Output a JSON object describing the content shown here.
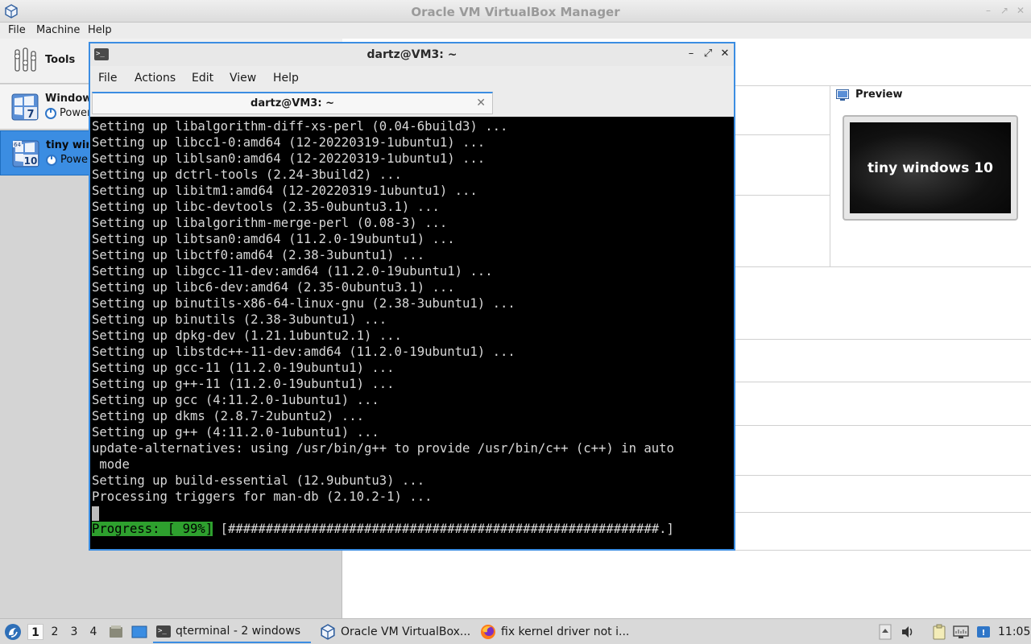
{
  "vbox": {
    "title": "Oracle VM VirtualBox Manager",
    "menu": {
      "file": "File",
      "machine": "Machine",
      "help": "Help"
    },
    "sidebar": {
      "tools_label": "Tools",
      "vms": [
        {
          "name": "Window",
          "state": "Power",
          "badge": "7"
        },
        {
          "name": "tiny win",
          "state": "Power",
          "badge": "10",
          "arch": "64"
        }
      ]
    },
    "preview": {
      "title": "Preview",
      "screen_text": "tiny windows 10"
    }
  },
  "terminal": {
    "title": "dartz@VM3: ~",
    "menu": [
      "File",
      "Actions",
      "Edit",
      "View",
      "Help"
    ],
    "tab_label": "dartz@VM3: ~",
    "lines": [
      "Setting up libalgorithm-diff-xs-perl (0.04-6build3) ...",
      "Setting up libcc1-0:amd64 (12-20220319-1ubuntu1) ...",
      "Setting up liblsan0:amd64 (12-20220319-1ubuntu1) ...",
      "Setting up dctrl-tools (2.24-3build2) ...",
      "Setting up libitm1:amd64 (12-20220319-1ubuntu1) ...",
      "Setting up libc-devtools (2.35-0ubuntu3.1) ...",
      "Setting up libalgorithm-merge-perl (0.08-3) ...",
      "Setting up libtsan0:amd64 (11.2.0-19ubuntu1) ...",
      "Setting up libctf0:amd64 (2.38-3ubuntu1) ...",
      "Setting up libgcc-11-dev:amd64 (11.2.0-19ubuntu1) ...",
      "Setting up libc6-dev:amd64 (2.35-0ubuntu3.1) ...",
      "Setting up binutils-x86-64-linux-gnu (2.38-3ubuntu1) ...",
      "Setting up binutils (2.38-3ubuntu1) ...",
      "Setting up dpkg-dev (1.21.1ubuntu2.1) ...",
      "Setting up libstdc++-11-dev:amd64 (11.2.0-19ubuntu1) ...",
      "Setting up gcc-11 (11.2.0-19ubuntu1) ...",
      "Setting up g++-11 (11.2.0-19ubuntu1) ...",
      "Setting up gcc (4:11.2.0-1ubuntu1) ...",
      "Setting up dkms (2.8.7-2ubuntu2) ...",
      "Setting up g++ (4:11.2.0-1ubuntu1) ...",
      "update-alternatives: using /usr/bin/g++ to provide /usr/bin/c++ (c++) in auto",
      " mode",
      "Setting up build-essential (12.9ubuntu3) ...",
      "Processing triggers for man-db (2.10.2-1) ..."
    ],
    "progress_label": "Progress: [ 99%]",
    "progress_bar": " [#########################################################.]",
    "progress_percent": 99
  },
  "taskbar": {
    "desktops": [
      "1",
      "2",
      "3",
      "4"
    ],
    "tasks": [
      {
        "label": "qterminal - 2 windows"
      },
      {
        "label": "Oracle VM VirtualBox..."
      },
      {
        "label": "fix kernel driver not i..."
      }
    ],
    "clock": "11:05"
  },
  "colors": {
    "accent": "#3b8de2",
    "progress_green": "#2ea02e",
    "terminal_bg": "#000000"
  }
}
